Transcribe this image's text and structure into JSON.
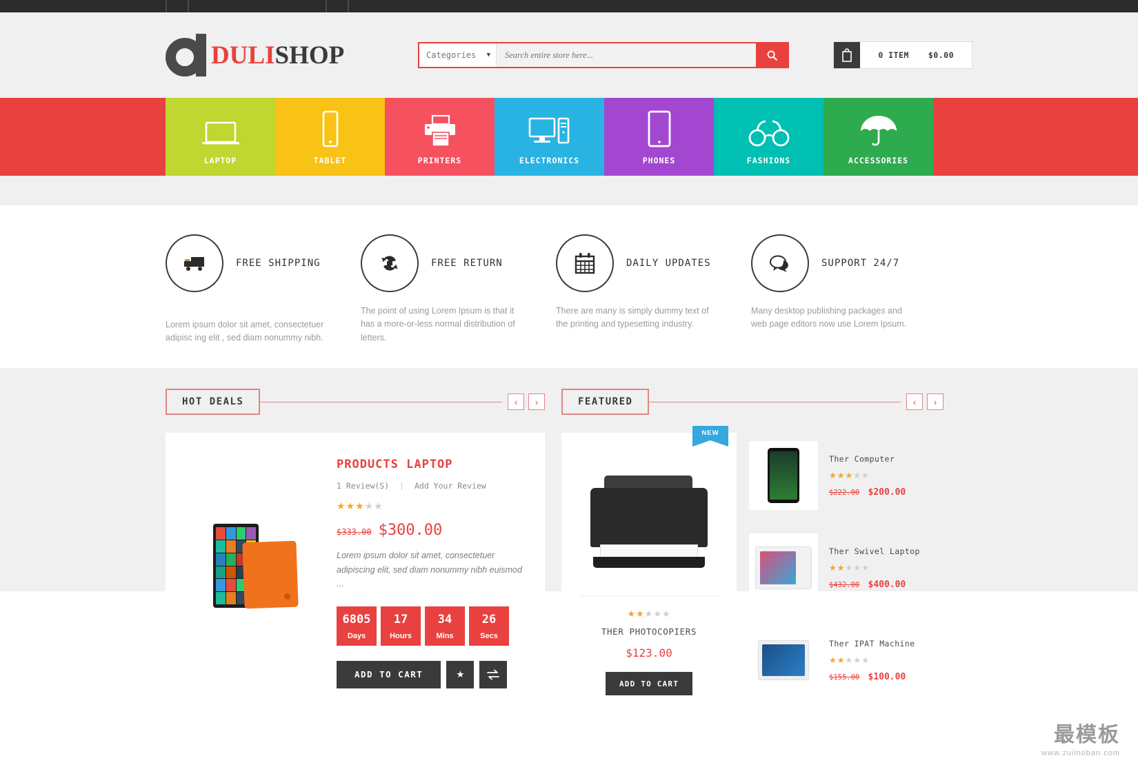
{
  "header": {
    "logo": {
      "brand_first": "DULI",
      "brand_second": "SHOP",
      "first_color": "#e8413f",
      "second_color": "#3a3a3a"
    },
    "search": {
      "category_label": "Categories",
      "placeholder": "Search entire store here...",
      "search_icon": "search-icon"
    },
    "cart": {
      "icon": "cart-bag-icon",
      "item_count": "0 ITEM",
      "total": "$0.00"
    }
  },
  "category_nav": {
    "items": [
      {
        "label": "LAPTOP",
        "color": "#bfd730",
        "icon": "laptop-icon"
      },
      {
        "label": "TABLET",
        "color": "#f9c216",
        "icon": "tablet-phone-icon"
      },
      {
        "label": "PRINTERS",
        "color": "#f5515f",
        "icon": "printer-icon"
      },
      {
        "label": "ELECTRONICS",
        "color": "#28b3e3",
        "icon": "desktop-computer-icon"
      },
      {
        "label": "PHONES",
        "color": "#a347d1",
        "icon": "tablet-icon"
      },
      {
        "label": "FASHIONS",
        "color": "#00bfb3",
        "icon": "glasses-icon"
      },
      {
        "label": "ACCESSORIES",
        "color": "#2eab4f",
        "icon": "umbrella-icon"
      }
    ],
    "background": "#e8413f"
  },
  "services": [
    {
      "title": "FREE SHIPPING",
      "icon": "truck-icon",
      "desc": "Lorem ipsum dolor sit amet, consectetuer adipisc ing elit , sed diam nonummy nibh."
    },
    {
      "title": "FREE RETURN",
      "icon": "refresh-icon",
      "desc": "The point of using Lorem Ipsum is that it has a more-or-less normal distribution of letters."
    },
    {
      "title": "DAILY UPDATES",
      "icon": "calendar-icon",
      "desc": "There are many is simply dummy text of the printing and typesetting industry."
    },
    {
      "title": "SUPPORT 24/7",
      "icon": "chat-bubbles-icon",
      "desc": "Many desktop publishing packages and web page editors now use Lorem Ipsum."
    }
  ],
  "hot_deals": {
    "section_title": "HOT DEALS",
    "prev_icon": "chevron-left-icon",
    "next_icon": "chevron-right-icon",
    "product": {
      "name": "PRODUCTS LAPTOP",
      "review_count": "1 Review(S)",
      "add_review": "Add Your Review",
      "rating": 2.5,
      "old_price": "$333.00",
      "new_price": "$300.00",
      "description": "Lorem ipsum dolor sit amet, consectetuer adipiscing elit, sed diam nonummy nibh euismod ...",
      "countdown": [
        {
          "value": "6805",
          "label": "Days"
        },
        {
          "value": "17",
          "label": "Hours"
        },
        {
          "value": "34",
          "label": "Mins"
        },
        {
          "value": "26",
          "label": "Secs"
        }
      ],
      "add_to_cart": "ADD TO CART",
      "wishlist_icon": "star-icon",
      "compare_icon": "compare-arrows-icon"
    }
  },
  "featured": {
    "section_title": "FEATURED",
    "prev_icon": "chevron-left-icon",
    "next_icon": "chevron-right-icon",
    "main_product": {
      "badge": "NEW",
      "badge_color": "#35a8dd",
      "image": "printer-photo",
      "rating": 2.5,
      "name": "THER PHOTOCOPIERS",
      "price": "$123.00",
      "add_to_cart": "ADD TO CART"
    },
    "side_products": [
      {
        "name": "Ther Computer",
        "rating": 2.5,
        "old_price": "$222.00",
        "new_price": "$200.00",
        "image": "smartphone-photo"
      },
      {
        "name": "Ther Swivel Laptop",
        "rating": 2.5,
        "old_price": "$432.00",
        "new_price": "$400.00",
        "image": "swivel-laptop-photo"
      },
      {
        "name": "Ther IPAT Machine",
        "rating": 2.5,
        "old_price": "$155.00",
        "new_price": "$100.00",
        "image": "tablet-photo"
      }
    ]
  },
  "watermark": {
    "main": "最模板",
    "sub": "www.zuimoban.com"
  }
}
